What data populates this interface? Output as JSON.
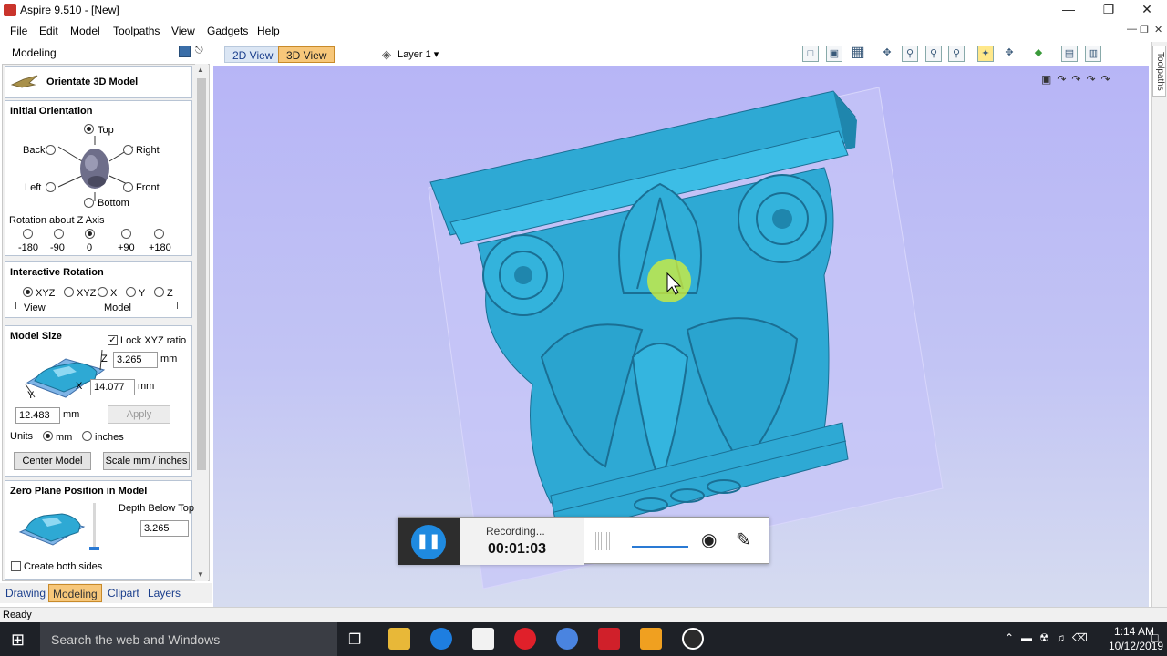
{
  "window": {
    "title": "Aspire 9.510 - [New]"
  },
  "menu": [
    "File",
    "Edit",
    "Model",
    "Toolpaths",
    "View",
    "Gadgets",
    "Help"
  ],
  "panel": {
    "header": "Modeling",
    "tool_title": "Orientate 3D Model",
    "initial_orientation": {
      "title": "Initial Orientation",
      "top": "Top",
      "back": "Back",
      "right": "Right",
      "left": "Left",
      "front": "Front",
      "bottom": "Bottom",
      "selected": "Top",
      "rotation_label": "Rotation about Z Axis",
      "rotations": [
        "-180",
        "-90",
        "0",
        "+90",
        "+180"
      ],
      "rotation_selected": "0"
    },
    "interactive_rotation": {
      "title": "Interactive Rotation",
      "options": [
        "XYZ",
        "XYZ",
        "X",
        "Y",
        "Z"
      ],
      "selected_index": 0,
      "view_label": "View",
      "model_label": "Model"
    },
    "model_size": {
      "title": "Model Size",
      "lock_label": "Lock XYZ ratio",
      "lock_checked": true,
      "z_label": "Z",
      "x_label": "X",
      "y_label": "Y",
      "z_value": "3.265",
      "x_value": "14.077",
      "y_value": "12.483",
      "unit": "mm",
      "apply_label": "Apply",
      "units_label": "Units",
      "unit_mm": "mm",
      "unit_inches": "inches",
      "units_selected": "mm",
      "center_label": "Center Model",
      "scale_label": "Scale mm / inches"
    },
    "zero_plane": {
      "title": "Zero Plane Position in Model",
      "depth_label": "Depth Below Top",
      "depth_value": "3.265",
      "create_both_label": "Create both sides"
    }
  },
  "bottom_tabs": [
    "Drawing",
    "Modeling",
    "Clipart",
    "Layers"
  ],
  "bottom_tab_active": "Modeling",
  "view_tabs": [
    "2D View",
    "3D View"
  ],
  "view_tab_active": "3D View",
  "layer_label": "Layer 1",
  "right_strip_label": "Toolpaths",
  "status": "Ready",
  "recorder": {
    "status": "Recording...",
    "time": "00:01:03"
  },
  "taskbar": {
    "search_placeholder": "Search the web and Windows",
    "time": "1:14 AM",
    "date": "10/12/2019"
  },
  "colors": {
    "model": "#2ea9d4",
    "accent": "#f7c77a",
    "viewport_top": "#b7b5f6"
  }
}
